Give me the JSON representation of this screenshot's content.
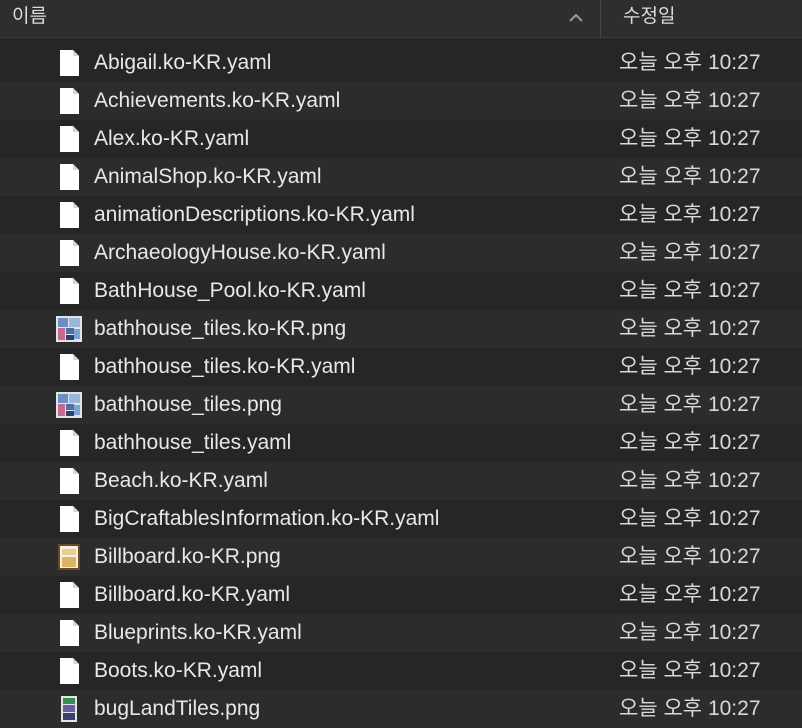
{
  "header": {
    "name_label": "이름",
    "date_label": "수정일"
  },
  "files": [
    {
      "name": "Abigail.ko-KR.yaml",
      "date": "오늘 오후 10:27",
      "icon": "document"
    },
    {
      "name": "Achievements.ko-KR.yaml",
      "date": "오늘 오후 10:27",
      "icon": "document"
    },
    {
      "name": "Alex.ko-KR.yaml",
      "date": "오늘 오후 10:27",
      "icon": "document"
    },
    {
      "name": "AnimalShop.ko-KR.yaml",
      "date": "오늘 오후 10:27",
      "icon": "document"
    },
    {
      "name": "animationDescriptions.ko-KR.yaml",
      "date": "오늘 오후 10:27",
      "icon": "document"
    },
    {
      "name": "ArchaeologyHouse.ko-KR.yaml",
      "date": "오늘 오후 10:27",
      "icon": "document"
    },
    {
      "name": "BathHouse_Pool.ko-KR.yaml",
      "date": "오늘 오후 10:27",
      "icon": "document"
    },
    {
      "name": "bathhouse_tiles.ko-KR.png",
      "date": "오늘 오후 10:27",
      "icon": "tiles-image"
    },
    {
      "name": "bathhouse_tiles.ko-KR.yaml",
      "date": "오늘 오후 10:27",
      "icon": "document"
    },
    {
      "name": "bathhouse_tiles.png",
      "date": "오늘 오후 10:27",
      "icon": "tiles-image"
    },
    {
      "name": "bathhouse_tiles.yaml",
      "date": "오늘 오후 10:27",
      "icon": "document"
    },
    {
      "name": "Beach.ko-KR.yaml",
      "date": "오늘 오후 10:27",
      "icon": "document"
    },
    {
      "name": "BigCraftablesInformation.ko-KR.yaml",
      "date": "오늘 오후 10:27",
      "icon": "document"
    },
    {
      "name": "Billboard.ko-KR.png",
      "date": "오늘 오후 10:27",
      "icon": "billboard-image"
    },
    {
      "name": "Billboard.ko-KR.yaml",
      "date": "오늘 오후 10:27",
      "icon": "document"
    },
    {
      "name": "Blueprints.ko-KR.yaml",
      "date": "오늘 오후 10:27",
      "icon": "document"
    },
    {
      "name": "Boots.ko-KR.yaml",
      "date": "오늘 오후 10:27",
      "icon": "document"
    },
    {
      "name": "bugLandTiles.png",
      "date": "오늘 오후 10:27",
      "icon": "bugland-image"
    }
  ]
}
